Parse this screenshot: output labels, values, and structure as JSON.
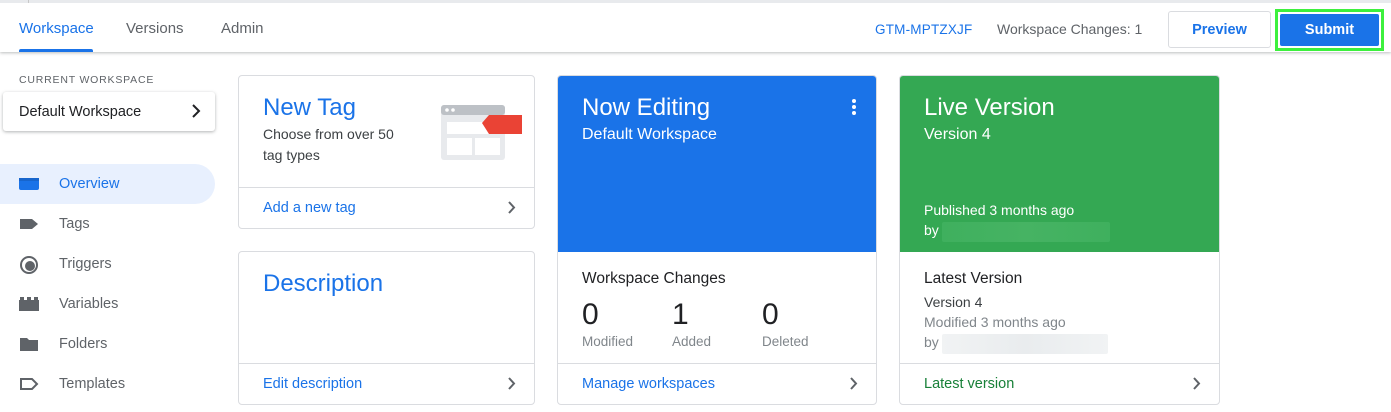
{
  "tabs": [
    {
      "label": "Workspace",
      "active": true
    },
    {
      "label": "Versions",
      "active": false
    },
    {
      "label": "Admin",
      "active": false
    }
  ],
  "header": {
    "container_id": "GTM-MPTZXJF",
    "workspace_changes": "Workspace Changes: 1",
    "preview_label": "Preview",
    "submit_label": "Submit"
  },
  "sidebar": {
    "current_workspace_label": "CURRENT WORKSPACE",
    "workspace_name": "Default Workspace",
    "items": [
      {
        "label": "Overview",
        "icon": "overview-icon",
        "active": true
      },
      {
        "label": "Tags",
        "icon": "tag-icon",
        "active": false
      },
      {
        "label": "Triggers",
        "icon": "trigger-icon",
        "active": false
      },
      {
        "label": "Variables",
        "icon": "variables-icon",
        "active": false
      },
      {
        "label": "Folders",
        "icon": "folder-icon",
        "active": false
      },
      {
        "label": "Templates",
        "icon": "template-icon",
        "active": false
      }
    ]
  },
  "new_tag_card": {
    "title": "New Tag",
    "subtitle": "Choose from over 50 tag types",
    "link": "Add a new tag"
  },
  "description_card": {
    "title": "Description",
    "link": "Edit description"
  },
  "now_editing_card": {
    "title": "Now Editing",
    "subtitle": "Default Workspace",
    "section_title": "Workspace Changes",
    "stats": [
      {
        "value": "0",
        "label": "Modified"
      },
      {
        "value": "1",
        "label": "Added"
      },
      {
        "value": "0",
        "label": "Deleted"
      }
    ],
    "link": "Manage workspaces"
  },
  "live_version_card": {
    "title": "Live Version",
    "subtitle": "Version 4",
    "published": "Published 3 months ago",
    "by": "by",
    "section_title": "Latest Version",
    "version": "Version 4",
    "modified": "Modified 3 months ago",
    "modified_by": "by",
    "link": "Latest version"
  },
  "colors": {
    "accent": "#1a73e8",
    "live_green": "#34a853",
    "submit_highlight": "#3df03d",
    "active_nav_bg": "#e8f0fe"
  }
}
